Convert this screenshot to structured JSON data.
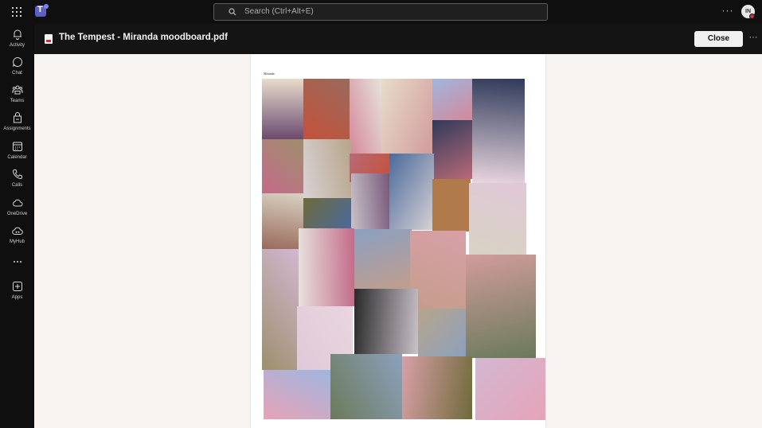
{
  "topbar": {
    "search_placeholder": "Search (Ctrl+Alt+E)",
    "avatar_initials": "IN",
    "more_label": "···"
  },
  "rail": {
    "items": [
      {
        "label": "Activity",
        "icon": "bell-icon"
      },
      {
        "label": "Chat",
        "icon": "chat-icon"
      },
      {
        "label": "Teams",
        "icon": "teams-icon"
      },
      {
        "label": "Assignments",
        "icon": "assignments-icon"
      },
      {
        "label": "Calendar",
        "icon": "calendar-icon"
      },
      {
        "label": "Calls",
        "icon": "phone-icon"
      },
      {
        "label": "OneDrive",
        "icon": "cloud-icon"
      },
      {
        "label": "MyHub",
        "icon": "myhub-icon"
      },
      {
        "label": "",
        "icon": "more-icon"
      },
      {
        "label": "Apps",
        "icon": "add-app-icon"
      }
    ]
  },
  "document": {
    "title": "The Tempest - Miranda moodboard.pdf",
    "close_label": "Close",
    "more_label": "···",
    "page_label": "Miranda"
  },
  "moodboard": {
    "tile_colors": [
      "#6b4a6e",
      "#c4513a",
      "#d4889a",
      "#e8dccb",
      "#9fb6e0",
      "#e9d6df",
      "#c46b8a",
      "#d8d2d6",
      "#b86a78",
      "#2f3a5a",
      "#9a6a5c",
      "#8da1bd",
      "#c9c2c9",
      "#4a6a9b",
      "#b07a4a",
      "#d8d3c3",
      "#9e8f6d",
      "#e6e2dc",
      "#6f6a3a",
      "#8aa0c2",
      "#c49d8a",
      "#e0c8d8",
      "#2a2a2a",
      "#b7a58a",
      "#d19c9c",
      "#e7a3b8",
      "#6a7a5a",
      "#d8a0a8",
      "#d2b8d2"
    ]
  }
}
